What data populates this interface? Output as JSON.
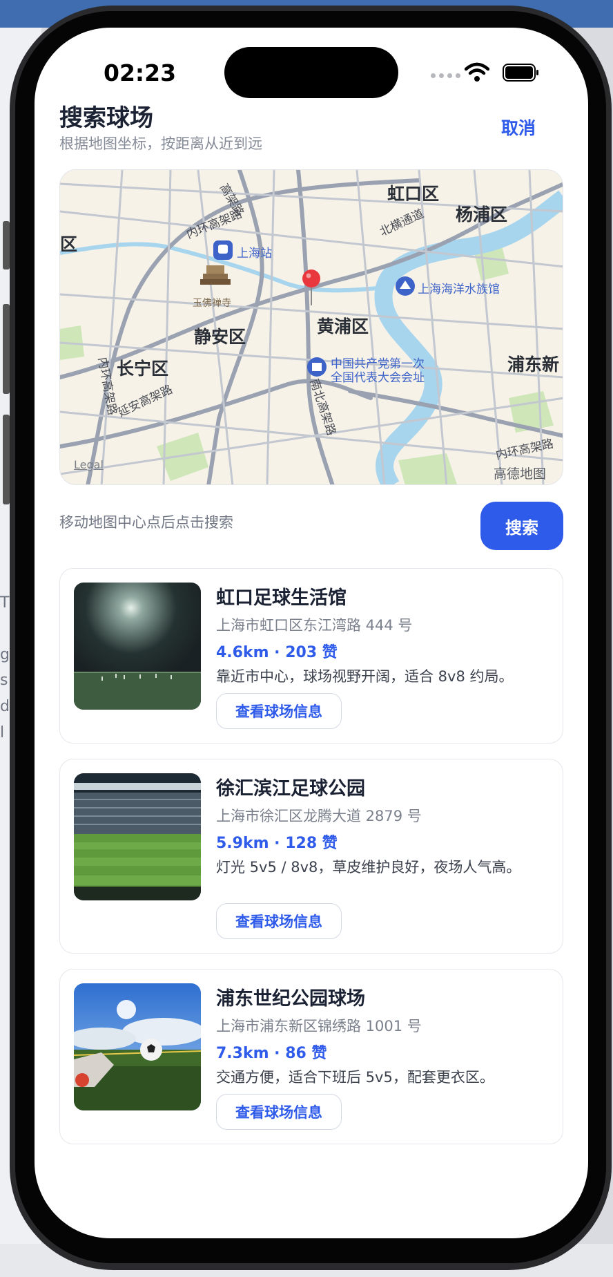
{
  "status_bar": {
    "time": "02:23"
  },
  "header": {
    "title": "搜索球场",
    "subtitle": "根据地图坐标，按距离从近到远",
    "cancel_label": "取消"
  },
  "map": {
    "district_labels": [
      "虹口区",
      "杨浦区",
      "区",
      "静安区",
      "黄浦区",
      "长宁区",
      "浦东新"
    ],
    "road_labels": [
      "内环高架路",
      "北横通道",
      "南北高架路",
      "延安高架路",
      "内环高架路",
      "内环高架路",
      "高架路"
    ],
    "pois": [
      "上海站",
      "玉佛禅寺",
      "上海海洋水族馆",
      "中国共产党第一次",
      "全国代表大会会址"
    ],
    "legal": "Legal",
    "attribution": "高德地图"
  },
  "search": {
    "hint": "移动地图中心点后点击搜索",
    "button_label": "搜索"
  },
  "results": [
    {
      "name": "虹口足球生活馆",
      "address": "上海市虹口区东江湾路 444 号",
      "meta": "4.6km · 203 赞",
      "description": "靠近市中心，球场视野开阔，适合 8v8 约局。",
      "button_label": "查看球场信息"
    },
    {
      "name": "徐汇滨江足球公园",
      "address": "上海市徐汇区龙腾大道 2879 号",
      "meta": "5.9km · 128 赞",
      "description": "灯光 5v5 / 8v8，草皮维护良好，夜场人气高。",
      "button_label": "查看球场信息"
    },
    {
      "name": "浦东世纪公园球场",
      "address": "上海市浦东新区锦绣路 1001 号",
      "meta": "7.3km · 86 赞",
      "description": "交通方便，适合下班后 5v5，配套更衣区。",
      "button_label": "查看球场信息"
    }
  ],
  "desktop_fragments": [
    "T",
    "g",
    "s",
    "d",
    "l"
  ],
  "colors": {
    "accent": "#2f5bea",
    "map_water": "#a8d5ee",
    "map_green": "#cfe7b8",
    "pin": "#e8383d"
  }
}
